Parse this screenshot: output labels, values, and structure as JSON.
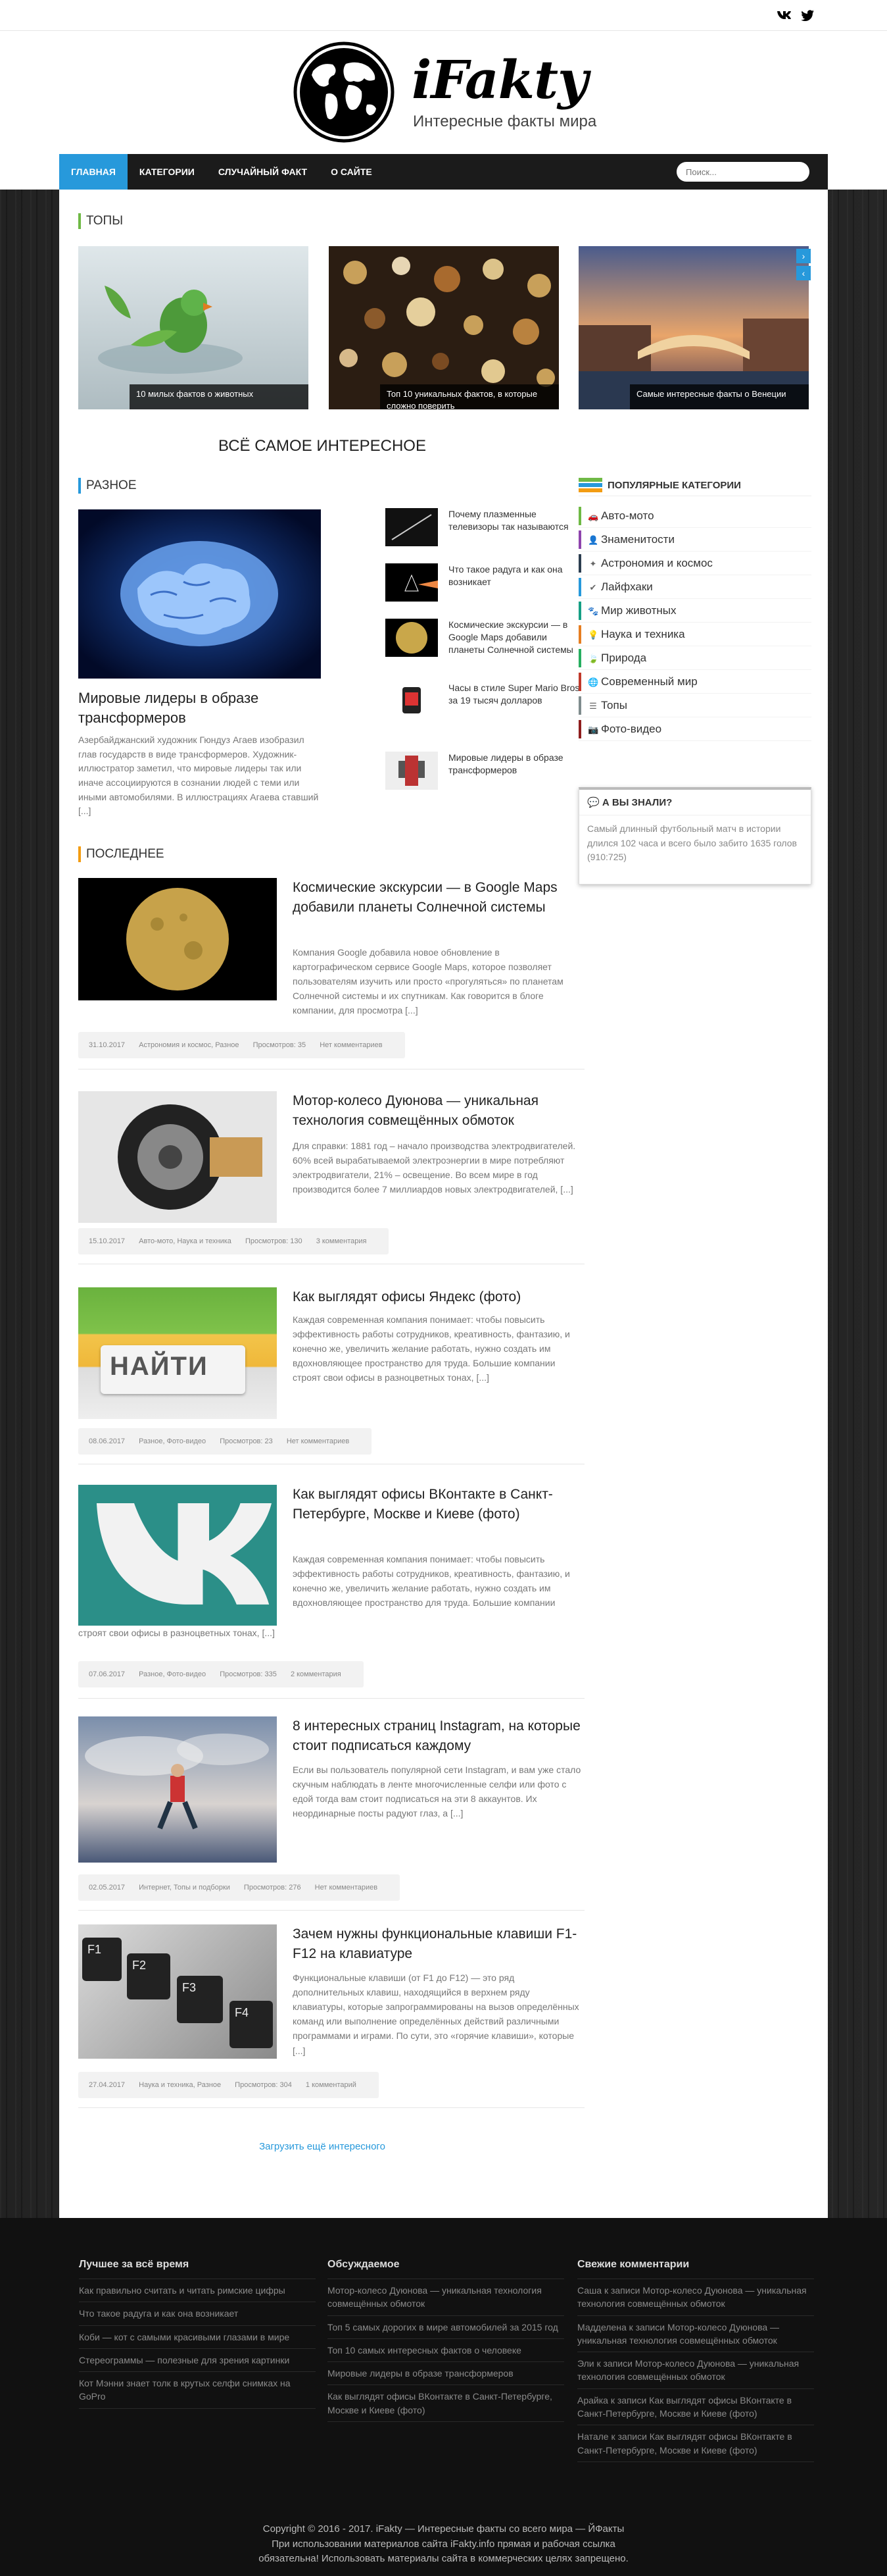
{
  "nav": {
    "items": [
      "Главная",
      "Категории",
      "Случайный факт",
      "О сайте"
    ],
    "search_placeholder": "Поиск..."
  },
  "logo": {
    "title": "iFakty",
    "subtitle": "Интересные факты мира"
  },
  "tops": {
    "heading": "ТОПЫ",
    "cards": [
      "10 милых фактов о животных",
      "Топ 10 уникальных фактов, в которые сложно поверить",
      "Самые интересные факты о Венеции"
    ]
  },
  "center_title": "ВСЁ САМОЕ ИНТЕРЕСНОЕ",
  "raznoe": {
    "heading": "РАЗНОЕ",
    "featured_title": "Мировые лидеры в образе трансформеров",
    "featured_text": "Азербайджанский художник Гюндуз Агаев изобразил глав государств в виде трансформеров. Художник-иллюстратор заметил, что мировые лидеры так или иначе ассоциируются в сознании людей с теми или иными автомобилями. В иллюстрациях Агаева ставший [...]",
    "side": [
      "Почему плазменные телевизоры так называются",
      "Что такое радуга и как она возникает",
      "Космические экскурсии — в Google Maps добавили планеты Солнечной системы",
      "Часы в стиле Super Mario Bros за 19 тысяч долларов",
      "Мировые лидеры в образе трансформеров"
    ]
  },
  "latest": {
    "heading": "ПОСЛЕДНЕЕ",
    "posts": [
      {
        "title": "Космические экскурсии — в Google Maps добавили планеты Солнечной системы",
        "text": "Компания Google добавила новое обновление в картографическом сервисе Google Maps, которое позволяет пользователям изучить или просто «прогуляться» по планетам Солнечной системы и их спутникам. Как говорится в блоге компании, для просмотра [...]",
        "date": "31.10.2017",
        "cats": "Астрономия и космос, Разное",
        "views": "Просмотров: 35",
        "comments": "Нет комментариев"
      },
      {
        "title": "Мотор-колесо Дуюнова — уникальная технология совмещённых обмоток",
        "text": "Для справки: 1881 год – начало производства электродвигателей. 60% всей вырабатываемой электроэнергии в мире потребляют электродвигатели, 21% – освещение. Во всем мире в год производится более 7 миллиардов новых электродвигателей, [...]",
        "date": "15.10.2017",
        "cats": "Авто-мото, Наука и техника",
        "views": "Просмотров: 130",
        "comments": "3 комментария"
      },
      {
        "title": "Как выглядят офисы Яндекс (фото)",
        "text": "Каждая современная компания понимает: чтобы повысить эффективность работы сотрудников, креативность, фантазию, и конечно же, увеличить желание работать, нужно создать им вдохновляющее пространство для труда. Большие компании строят свои офисы в разноцветных тонах, [...]",
        "date": "08.06.2017",
        "cats": "Разное, Фото-видео",
        "views": "Просмотров: 23",
        "comments": "Нет комментариев",
        "img_label": "НАЙТИ"
      },
      {
        "title": "Как выглядят офисы ВКонтакте в Санкт-Петербурге, Москве и Киеве (фото)",
        "text": "Каждая современная компания понимает: чтобы повысить эффективность работы сотрудников, креативность, фантазию, и конечно же, увеличить желание работать, нужно создать им вдохновляющее пространство для труда. Большие компании",
        "text2": "строят свои офисы в разноцветных тонах, [...]",
        "date": "07.06.2017",
        "cats": "Разное, Фото-видео",
        "views": "Просмотров: 335",
        "comments": "2 комментария"
      },
      {
        "title": "8 интересных страниц Instagram, на которые стоит подписаться каждому",
        "text": "Если вы пользователь популярной сети Instagram, и вам уже стало скучным наблюдать в ленте многочисленные селфи или фото с едой тогда вам стоит подписаться на эти 8 аккаунтов. Их неординарные посты радуют глаз, а [...]",
        "date": "02.05.2017",
        "cats": "Интернет, Топы и подборки",
        "views": "Просмотров: 276",
        "comments": "Нет комментариев"
      },
      {
        "title": "Зачем нужны функциональные клавиши F1-F12 на клавиатуре",
        "text": "Функциональные клавиши (от F1 до F12) — это ряд дополнительных клавиш, находящийся в верхнем ряду клавиатуры, которые запрограммированы на вызов определённых команд или выполнение определённых действий различными программами и играми. По сути, это «горячие клавиши», которые [...]",
        "date": "27.04.2017",
        "cats": "Наука и техника, Разное",
        "views": "Просмотров: 304",
        "comments": "1 комментарий",
        "keys": [
          "F1",
          "F2",
          "F3",
          "F4"
        ]
      }
    ],
    "load_more": "Загрузить ещё интересного"
  },
  "sidebar": {
    "categories_heading": "ПОПУЛЯРНЫЕ КАТЕГОРИИ",
    "categories": [
      {
        "label": "Авто-мото",
        "color": "#6fb945"
      },
      {
        "label": "Знаменитости",
        "color": "#8e44ad"
      },
      {
        "label": "Астрономия и космос",
        "color": "#2c3e50"
      },
      {
        "label": "Лайфхаки",
        "color": "#2799db"
      },
      {
        "label": "Мир животных",
        "color": "#16a085"
      },
      {
        "label": "Наука и техника",
        "color": "#e67e22"
      },
      {
        "label": "Природа",
        "color": "#27ae60"
      },
      {
        "label": "Современный мир",
        "color": "#c0392b"
      },
      {
        "label": "Топы",
        "color": "#7f8c8d"
      },
      {
        "label": "Фото-видео",
        "color": "#8e1e1e"
      }
    ],
    "didyou_heading": "А ВЫ ЗНАЛИ?",
    "didyou_text": "Самый длинный футбольный матч в истории длился 102 часа и всего было забито 1635 голов (910:725)"
  },
  "footer": {
    "col1": {
      "heading": "Лучшее за всё время",
      "items": [
        "Как правильно считать и читать римские цифры",
        "Что такое радуга и как она возникает",
        "Коби — кот с самыми красивыми глазами в мире",
        "Стереограммы — полезные для зрения картинки",
        "Кот Мэнни знает толк в крутых селфи снимках на GoPro"
      ]
    },
    "col2": {
      "heading": "Обсуждаемое",
      "items": [
        "Мотор-колесо Дуюнова — уникальная технология совмещённых обмоток",
        "Топ 5 самых дорогих в мире автомобилей за 2015 год",
        "Топ 10 самых интересных фактов о человеке",
        "Мировые лидеры в образе трансформеров",
        "Как выглядят офисы ВКонтакте в Санкт-Петербурге, Москве и Киеве (фото)"
      ]
    },
    "col3": {
      "heading": "Свежие комментарии",
      "items": [
        "Саша к записи Мотор-колесо Дуюнова — уникальная технология совмещённых обмоток",
        "Мадделена к записи Мотор-колесо Дуюнова — уникальная технология совмещённых обмоток",
        "Эли к записи Мотор-колесо Дуюнова — уникальная технология совмещённых обмоток",
        "Арайка к записи Как выглядят офисы ВКонтакте в Санкт-Петербурге, Москве и Киеве (фото)",
        "Натале к записи Как выглядят офисы ВКонтакте в Санкт-Петербурге, Москве и Киеве (фото)"
      ]
    },
    "copyright": "Copyright © 2016 - 2017. iFakty — Интересные факты со всего мира — ЙФакты",
    "notice": "При использовании материалов сайта iFakty.info прямая и рабочая ссылка обязательна! Использовать материалы сайта в коммерческих целях запрещено."
  },
  "colors": {
    "accent": "#2799db",
    "nav_bg": "#1b1b1b",
    "footer_bg": "#111111",
    "tops_marker": "#6fb945",
    "latest_marker": "#f39c12"
  }
}
